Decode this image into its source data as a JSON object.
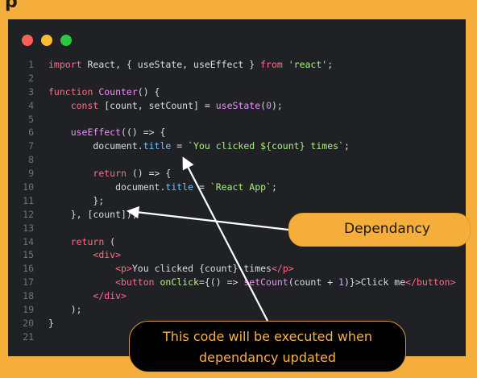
{
  "page": {
    "top_fragment": "p"
  },
  "window": {
    "controls": [
      "close",
      "minimize",
      "maximize"
    ]
  },
  "code": {
    "lines": [
      {
        "n": "1",
        "segments": [
          {
            "c": "kw",
            "t": "import "
          },
          {
            "c": "var",
            "t": "React, { useState, useEffect } "
          },
          {
            "c": "kw",
            "t": "from "
          },
          {
            "c": "str",
            "t": "'react'"
          },
          {
            "c": "punc",
            "t": ";"
          }
        ]
      },
      {
        "n": "2",
        "segments": []
      },
      {
        "n": "3",
        "segments": [
          {
            "c": "kw",
            "t": "function "
          },
          {
            "c": "fn",
            "t": "Counter"
          },
          {
            "c": "punc",
            "t": "() {"
          }
        ]
      },
      {
        "n": "4",
        "segments": [
          {
            "c": "var",
            "t": "    "
          },
          {
            "c": "kw",
            "t": "const "
          },
          {
            "c": "punc",
            "t": "[count, setCount] = "
          },
          {
            "c": "fn",
            "t": "useState"
          },
          {
            "c": "punc",
            "t": "("
          },
          {
            "c": "num",
            "t": "0"
          },
          {
            "c": "punc",
            "t": ");"
          }
        ]
      },
      {
        "n": "5",
        "segments": []
      },
      {
        "n": "6",
        "segments": [
          {
            "c": "var",
            "t": "    "
          },
          {
            "c": "fn",
            "t": "useEffect"
          },
          {
            "c": "punc",
            "t": "(() => {"
          }
        ]
      },
      {
        "n": "7",
        "segments": [
          {
            "c": "var",
            "t": "        document."
          },
          {
            "c": "prop",
            "t": "title"
          },
          {
            "c": "punc",
            "t": " = "
          },
          {
            "c": "str",
            "t": "`You clicked ${count} times`"
          },
          {
            "c": "punc",
            "t": ";"
          }
        ]
      },
      {
        "n": "8",
        "segments": []
      },
      {
        "n": "9",
        "segments": [
          {
            "c": "var",
            "t": "        "
          },
          {
            "c": "kw",
            "t": "return "
          },
          {
            "c": "punc",
            "t": "() => {"
          }
        ]
      },
      {
        "n": "10",
        "segments": [
          {
            "c": "var",
            "t": "            document."
          },
          {
            "c": "prop",
            "t": "title"
          },
          {
            "c": "punc",
            "t": " = "
          },
          {
            "c": "str",
            "t": "`React App`"
          },
          {
            "c": "punc",
            "t": ";"
          }
        ]
      },
      {
        "n": "11",
        "segments": [
          {
            "c": "punc",
            "t": "        };"
          }
        ]
      },
      {
        "n": "12",
        "segments": [
          {
            "c": "punc",
            "t": "    }, [count]);"
          }
        ]
      },
      {
        "n": "13",
        "segments": []
      },
      {
        "n": "14",
        "segments": [
          {
            "c": "var",
            "t": "    "
          },
          {
            "c": "kw",
            "t": "return "
          },
          {
            "c": "punc",
            "t": "("
          }
        ]
      },
      {
        "n": "15",
        "segments": [
          {
            "c": "var",
            "t": "        "
          },
          {
            "c": "tag",
            "t": "<div>"
          }
        ]
      },
      {
        "n": "16",
        "segments": [
          {
            "c": "var",
            "t": "            "
          },
          {
            "c": "tag",
            "t": "<p>"
          },
          {
            "c": "var",
            "t": "You clicked {count} times"
          },
          {
            "c": "tag",
            "t": "</p>"
          }
        ]
      },
      {
        "n": "17",
        "segments": [
          {
            "c": "var",
            "t": "            "
          },
          {
            "c": "tag",
            "t": "<button "
          },
          {
            "c": "attr",
            "t": "onClick"
          },
          {
            "c": "punc",
            "t": "={() => "
          },
          {
            "c": "fn",
            "t": "setCount"
          },
          {
            "c": "punc",
            "t": "(count + "
          },
          {
            "c": "num",
            "t": "1"
          },
          {
            "c": "punc",
            "t": ")}>Click me"
          },
          {
            "c": "tag",
            "t": "</button>"
          }
        ]
      },
      {
        "n": "18",
        "segments": [
          {
            "c": "var",
            "t": "        "
          },
          {
            "c": "tag",
            "t": "</div>"
          }
        ]
      },
      {
        "n": "19",
        "segments": [
          {
            "c": "punc",
            "t": "    );"
          }
        ]
      },
      {
        "n": "20",
        "segments": [
          {
            "c": "punc",
            "t": "}"
          }
        ]
      },
      {
        "n": "21",
        "segments": []
      }
    ]
  },
  "annotations": {
    "dependency_label": "Dependancy",
    "execution_line1": "This code will be executed when",
    "execution_line2": "dependancy updated"
  },
  "colors": {
    "background": "#f5ad3b",
    "editor_bg": "#1f2124",
    "callout_text": "#f8b04b"
  }
}
